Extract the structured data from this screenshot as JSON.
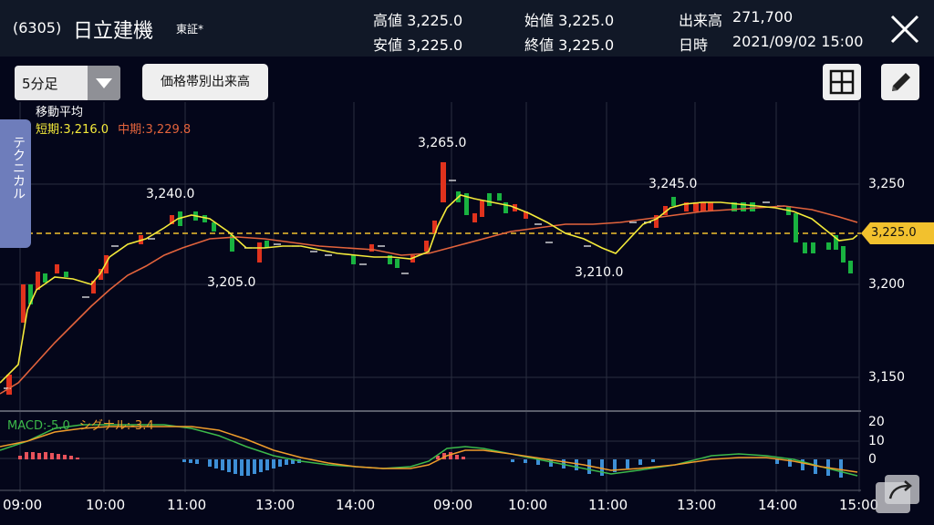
{
  "header": {
    "code": "(6305)",
    "name": "日立建機",
    "exchange": "東証*",
    "high": "高値 3,225.0",
    "low": "安値 3,225.0",
    "open": "始値 3,225.0",
    "close": "終値 3,225.0",
    "volume_label": "出来高",
    "volume": "271,700",
    "datetime_label": "日時",
    "datetime": "2021/09/02 15:00"
  },
  "toolbar": {
    "timeframe": "5分足",
    "volume_profile": "価格帯別出来高",
    "layout_icon": "grid-icon",
    "draw_icon": "pencil-icon"
  },
  "side_tab": "テクニカル",
  "moving_average": {
    "title": "移動平均",
    "short": "短期:3,216.0",
    "mid": "中期:3,229.8"
  },
  "price_axis": [
    "3,250",
    "3,225.0",
    "3,200",
    "3,150"
  ],
  "annotations": [
    "3,265.0",
    "3,240.0",
    "3,245.0",
    "3,205.0",
    "3,210.0"
  ],
  "macd": {
    "macd": "MACD:-5.0",
    "signal": "シグナル:-3.4",
    "axis": [
      "20",
      "10",
      "0"
    ]
  },
  "time_axis": [
    "09:00",
    "10:00",
    "11:00",
    "13:00",
    "14:00",
    "09:00",
    "10:00",
    "11:00",
    "13:00",
    "14:00",
    "15:00"
  ],
  "colors": {
    "up": "#e0321d",
    "down": "#19b240",
    "short_ma": "#f4ea3a",
    "mid_ma": "#e3633c",
    "current_price": "#f2c12e",
    "macd_line": "#3cb94a",
    "signal_line": "#ef9c2b"
  },
  "chart_data": {
    "type": "line",
    "series": [
      {
        "name": "短期",
        "values": [
          3140,
          3198,
          3205,
          3202,
          3210,
          3223,
          3236,
          3238,
          3230,
          3215,
          3220,
          3219,
          3218,
          3214,
          3213,
          3215,
          3240,
          3241,
          3235,
          3232,
          3226,
          3220,
          3218,
          3212,
          3226,
          3236,
          3238,
          3237,
          3237,
          3229,
          3218
        ]
      },
      {
        "name": "中期",
        "values": [
          3146,
          3160,
          3178,
          3194,
          3208,
          3219,
          3221,
          3220,
          3219,
          3220,
          3220,
          3220,
          3218,
          3223,
          3228,
          3232,
          3230,
          3227,
          3228,
          3232,
          3236,
          3236,
          3236,
          3236,
          3229
        ]
      }
    ],
    "current_price": 3225.0,
    "ylim": [
      3140,
      3275
    ],
    "yticks": [
      3150,
      3200,
      3250
    ],
    "xticks": [
      "09:00",
      "10:00",
      "11:00",
      "13:00",
      "14:00",
      "09:00",
      "10:00",
      "11:00",
      "13:00",
      "14:00",
      "15:00"
    ]
  }
}
